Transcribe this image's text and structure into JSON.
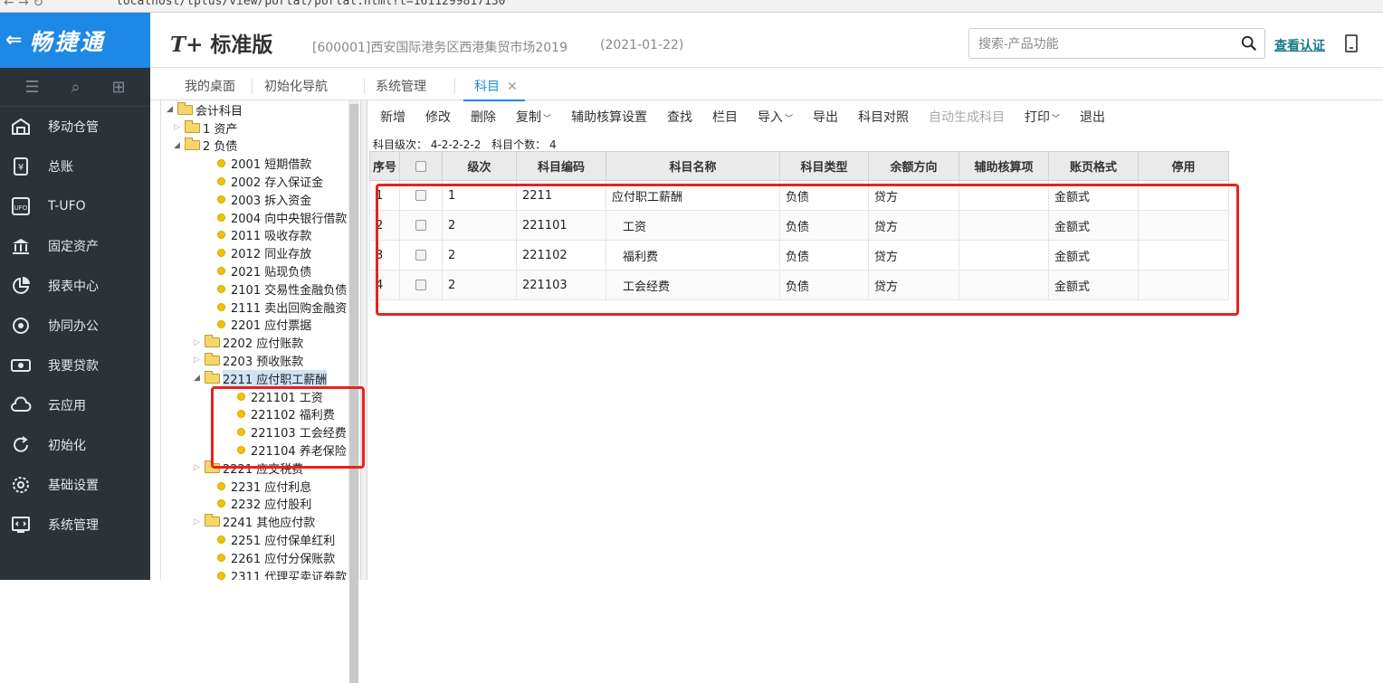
{
  "browser": {
    "nav_glyphs": "← → ↻",
    "url": "localhost/tplus/view/portal/portal.html?t=1611299817130"
  },
  "header": {
    "brand": "畅捷通",
    "product_prefix": "T+",
    "product_name": "标准版",
    "company": "[600001]西安国际港务区西港集贸市场2019",
    "date": "(2021-01-22)",
    "search_placeholder": "搜索-产品功能",
    "certify": "查看认证"
  },
  "sidebar": {
    "items": [
      {
        "label": "移动仓管",
        "icon": "warehouse-icon"
      },
      {
        "label": "总账",
        "icon": "ledger-icon"
      },
      {
        "label": "T-UFO",
        "icon": "ufo-icon"
      },
      {
        "label": "固定资产",
        "icon": "bank-icon"
      },
      {
        "label": "报表中心",
        "icon": "chart-pie-icon"
      },
      {
        "label": "协同办公",
        "icon": "collab-icon"
      },
      {
        "label": "我要贷款",
        "icon": "money-icon"
      },
      {
        "label": "云应用",
        "icon": "cloud-icon"
      },
      {
        "label": "初始化",
        "icon": "refresh-icon"
      },
      {
        "label": "基础设置",
        "icon": "settings-icon"
      },
      {
        "label": "系统管理",
        "icon": "code-icon"
      }
    ]
  },
  "tabs": [
    {
      "label": "我的桌面"
    },
    {
      "label": "初始化导航"
    },
    {
      "label": "系统管理"
    },
    {
      "label": "科目",
      "active": true
    }
  ],
  "tree": {
    "root": "会计科目",
    "nodes": [
      {
        "label": "1 资产"
      },
      {
        "label": "2 负债"
      },
      {
        "label": "2001 短期借款"
      },
      {
        "label": "2002 存入保证金"
      },
      {
        "label": "2003 拆入资金"
      },
      {
        "label": "2004 向中央银行借款"
      },
      {
        "label": "2011 吸收存款"
      },
      {
        "label": "2012 同业存放"
      },
      {
        "label": "2021 贴现负债"
      },
      {
        "label": "2101 交易性金融负债"
      },
      {
        "label": "2111 卖出回购金融资"
      },
      {
        "label": "2201 应付票据"
      },
      {
        "label": "2202 应付账款"
      },
      {
        "label": "2203 预收账款"
      },
      {
        "label": "2211 应付职工薪酬"
      },
      {
        "label": "221101 工资"
      },
      {
        "label": "221102 福利费"
      },
      {
        "label": "221103 工会经费"
      },
      {
        "label": "221104 养老保险"
      },
      {
        "label": "2221 应交税费"
      },
      {
        "label": "2231 应付利息"
      },
      {
        "label": "2232 应付股利"
      },
      {
        "label": "2241 其他应付款"
      },
      {
        "label": "2251 应付保单红利"
      },
      {
        "label": "2261 应付分保账款"
      },
      {
        "label": "2311 代理买卖证券款"
      }
    ]
  },
  "toolbar": {
    "buttons": [
      "新增",
      "修改",
      "删除",
      "复制",
      "辅助核算设置",
      "查找",
      "栏目",
      "导入",
      "导出",
      "科目对照",
      "自动生成科目",
      "打印",
      "退出"
    ]
  },
  "meta": {
    "levels_label": "科目级次：",
    "levels": "4-2-2-2-2",
    "count_label": "科目个数：",
    "count": "4"
  },
  "table": {
    "headers": [
      "序号",
      "",
      "级次",
      "科目编码",
      "科目名称",
      "科目类型",
      "余额方向",
      "辅助核算项",
      "账页格式",
      "停用"
    ],
    "rows": [
      {
        "no": "1",
        "level": "1",
        "code": "2211",
        "name": "应付职工薪酬",
        "type": "负债",
        "direction": "贷方",
        "aux": "",
        "format": "金额式",
        "disabled": ""
      },
      {
        "no": "2",
        "level": "2",
        "code": "221101",
        "name": "工资",
        "type": "负债",
        "direction": "贷方",
        "aux": "",
        "format": "金额式",
        "disabled": ""
      },
      {
        "no": "3",
        "level": "2",
        "code": "221102",
        "name": "福利费",
        "type": "负债",
        "direction": "贷方",
        "aux": "",
        "format": "金额式",
        "disabled": ""
      },
      {
        "no": "4",
        "level": "2",
        "code": "221103",
        "name": "工会经费",
        "type": "负债",
        "direction": "贷方",
        "aux": "",
        "format": "金额式",
        "disabled": ""
      }
    ]
  },
  "colors": {
    "brand": "#1e88e5",
    "sidebar": "#2b3238",
    "highlight": "#e6231f"
  }
}
